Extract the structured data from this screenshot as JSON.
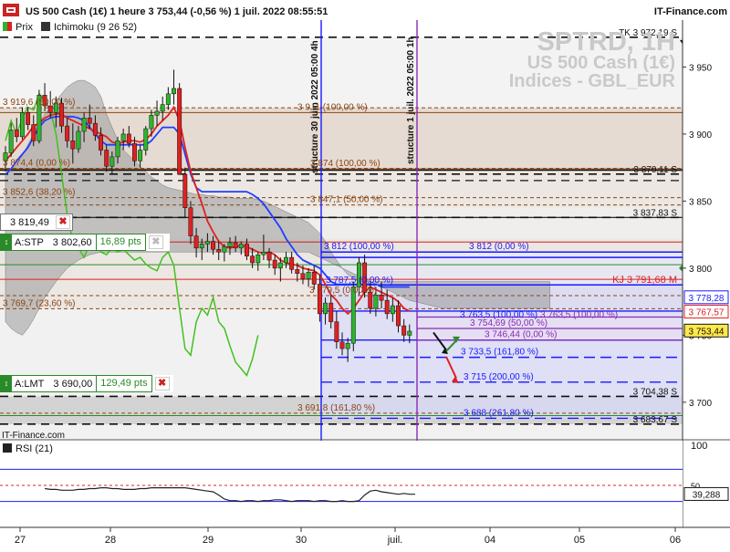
{
  "header": {
    "title": "US 500 Cash (1€) 1 heure 3 753,44 (-0,56 %) 1 juil. 2022 08:55:51",
    "brand": "IT-Finance.com"
  },
  "legend": {
    "price_label": "Prix",
    "ichimoku_label": "Ichimoku (9 26 52)"
  },
  "watermark": {
    "symbol": "SPTRD, 1H",
    "name": "US 500 Cash (1€)",
    "group": "Indices - GBL_EUR"
  },
  "footer_brand": "IT-Finance.com",
  "colors": {
    "price_up": "#2db52d",
    "price_down": "#e02020",
    "tenkan": "#e02020",
    "kijun": "#1f3fff",
    "chikou": "#44c020",
    "cloud": "#9a9a9a",
    "fib": "#8b4513",
    "projection": "#1a1aff",
    "vertical_magenta": "#8a2bb5",
    "rsi": "#222222"
  },
  "chart_data": [
    {
      "type": "line",
      "title": "US 500 Cash (1€) 1 heure",
      "ylim": [
        3672,
        3985
      ],
      "y_ticks": [
        3950,
        3900,
        3850,
        3800,
        3750,
        3700
      ],
      "y_tick_labels": [
        "3 950",
        "3 900",
        "3 850",
        "3 800",
        "3 750",
        "3 700"
      ],
      "x_tick_labels": [
        "27",
        "28",
        "29",
        "30",
        "juil.",
        "04",
        "05",
        "06"
      ],
      "grid": false,
      "candles": [
        [
          3880,
          3891,
          3872,
          3886
        ],
        [
          3886,
          3908,
          3883,
          3903
        ],
        [
          3903,
          3912,
          3894,
          3898
        ],
        [
          3898,
          3920,
          3896,
          3916
        ],
        [
          3916,
          3920,
          3903,
          3907
        ],
        [
          3907,
          3914,
          3891,
          3895
        ],
        [
          3895,
          3933,
          3893,
          3929
        ],
        [
          3929,
          3938,
          3917,
          3921
        ],
        [
          3921,
          3932,
          3912,
          3916
        ],
        [
          3916,
          3928,
          3905,
          3923
        ],
        [
          3923,
          3927,
          3901,
          3906
        ],
        [
          3906,
          3912,
          3890,
          3895
        ],
        [
          3895,
          3908,
          3878,
          3889
        ],
        [
          3889,
          3906,
          3886,
          3902
        ],
        [
          3902,
          3916,
          3894,
          3912
        ],
        [
          3912,
          3922,
          3904,
          3908
        ],
        [
          3908,
          3914,
          3895,
          3899
        ],
        [
          3899,
          3905,
          3884,
          3888
        ],
        [
          3888,
          3892,
          3872,
          3876
        ],
        [
          3876,
          3887,
          3870,
          3883
        ],
        [
          3883,
          3898,
          3878,
          3895
        ],
        [
          3895,
          3904,
          3888,
          3900
        ],
        [
          3900,
          3906,
          3890,
          3893
        ],
        [
          3893,
          3898,
          3876,
          3880
        ],
        [
          3880,
          3892,
          3875,
          3888
        ],
        [
          3888,
          3906,
          3884,
          3904
        ],
        [
          3904,
          3918,
          3898,
          3914
        ],
        [
          3914,
          3925,
          3906,
          3917
        ],
        [
          3917,
          3928,
          3910,
          3922
        ],
        [
          3922,
          3935,
          3918,
          3930
        ],
        [
          3930,
          3948,
          3922,
          3934
        ],
        [
          3934,
          3938,
          3885,
          3870
        ],
        [
          3870,
          3875,
          3838,
          3845
        ],
        [
          3845,
          3850,
          3818,
          3824
        ],
        [
          3824,
          3830,
          3808,
          3815
        ],
        [
          3815,
          3822,
          3806,
          3818
        ],
        [
          3818,
          3826,
          3812,
          3820
        ],
        [
          3820,
          3824,
          3810,
          3814
        ],
        [
          3814,
          3820,
          3806,
          3812
        ],
        [
          3812,
          3818,
          3805,
          3816
        ],
        [
          3816,
          3823,
          3810,
          3819
        ],
        [
          3819,
          3824,
          3812,
          3815
        ],
        [
          3815,
          3820,
          3810,
          3818
        ],
        [
          3818,
          3822,
          3806,
          3809
        ],
        [
          3809,
          3815,
          3800,
          3804
        ],
        [
          3804,
          3812,
          3798,
          3810
        ],
        [
          3810,
          3825,
          3806,
          3812
        ],
        [
          3812,
          3815,
          3800,
          3806
        ],
        [
          3806,
          3810,
          3795,
          3800
        ],
        [
          3800,
          3808,
          3790,
          3804
        ],
        [
          3804,
          3812,
          3800,
          3808
        ],
        [
          3808,
          3812,
          3796,
          3799
        ],
        [
          3799,
          3804,
          3790,
          3796
        ],
        [
          3796,
          3802,
          3788,
          3792
        ],
        [
          3792,
          3800,
          3786,
          3797
        ],
        [
          3797,
          3802,
          3784,
          3788
        ],
        [
          3788,
          3795,
          3760,
          3766
        ],
        [
          3766,
          3778,
          3758,
          3774
        ],
        [
          3774,
          3780,
          3755,
          3760
        ],
        [
          3760,
          3768,
          3740,
          3745
        ],
        [
          3745,
          3752,
          3735,
          3740
        ],
        [
          3740,
          3748,
          3730,
          3744
        ],
        [
          3744,
          3790,
          3738,
          3786
        ],
        [
          3786,
          3808,
          3780,
          3804
        ],
        [
          3804,
          3810,
          3778,
          3782
        ],
        [
          3782,
          3790,
          3766,
          3770
        ],
        [
          3770,
          3786,
          3764,
          3780
        ],
        [
          3780,
          3790,
          3770,
          3776
        ],
        [
          3776,
          3784,
          3762,
          3766
        ],
        [
          3766,
          3778,
          3760,
          3772
        ],
        [
          3772,
          3776,
          3752,
          3757
        ],
        [
          3757,
          3762,
          3745,
          3750
        ],
        [
          3750,
          3758,
          3744,
          3753
        ]
      ],
      "tenkan": [
        3880,
        3885,
        3890,
        3895,
        3900,
        3906,
        3908,
        3912,
        3914,
        3915,
        3915,
        3912,
        3910,
        3908,
        3906,
        3904,
        3902,
        3900,
        3898,
        3894,
        3893,
        3894,
        3895,
        3895,
        3894,
        3896,
        3900,
        3906,
        3910,
        3914,
        3920,
        3910,
        3890,
        3872,
        3860,
        3848,
        3835,
        3827,
        3820,
        3816,
        3815,
        3816,
        3817,
        3816,
        3814,
        3812,
        3811,
        3812,
        3810,
        3806,
        3804,
        3803,
        3802,
        3800,
        3799,
        3798,
        3795,
        3788,
        3780,
        3776,
        3770,
        3766,
        3770,
        3776,
        3782,
        3786,
        3784,
        3782,
        3780,
        3778,
        3775,
        3770,
        3768
      ],
      "kijun": [
        3870,
        3874,
        3880,
        3885,
        3890,
        3898,
        3905,
        3910,
        3912,
        3913,
        3913,
        3913,
        3913,
        3912,
        3910,
        3905,
        3900,
        3895,
        3892,
        3892,
        3892,
        3892,
        3892,
        3892,
        3892,
        3892,
        3895,
        3900,
        3905,
        3905,
        3905,
        3900,
        3885,
        3870,
        3860,
        3857,
        3857,
        3857,
        3857,
        3857,
        3857,
        3857,
        3857,
        3857,
        3855,
        3852,
        3848,
        3842,
        3836,
        3830,
        3822,
        3816,
        3810,
        3806,
        3804,
        3802,
        3800,
        3795,
        3790,
        3788,
        3788,
        3788,
        3788,
        3788,
        3788,
        3788,
        3788,
        3786,
        3786,
        3786,
        3786,
        3786,
        3786
      ],
      "chikou": [
        3895,
        3910,
        3900,
        3912,
        3920,
        3918,
        3930,
        3925,
        3918,
        3900,
        3870,
        3840,
        3820,
        3815,
        3808,
        3818,
        3822,
        3812,
        3810,
        3815,
        3812,
        3814,
        3810,
        3806,
        3808,
        3803,
        3800,
        3798,
        3808,
        3812,
        3802,
        3770,
        3740,
        3735,
        3760,
        3770,
        3765,
        3778,
        3760,
        3755,
        3742,
        3730,
        3725,
        3720,
        3732,
        3750
      ],
      "cloud_top": [
        3870,
        3872,
        3878,
        3884,
        3892,
        3900,
        3908,
        3915,
        3920,
        3925,
        3930,
        3935,
        3938,
        3940,
        3940,
        3938,
        3935,
        3928,
        3915,
        3905,
        3895,
        3888,
        3884,
        3880,
        3876,
        3872,
        3868,
        3865,
        3862,
        3860,
        3859,
        3858,
        3857,
        3856,
        3855,
        3855,
        3854,
        3854,
        3853,
        3853,
        3853,
        3852,
        3852,
        3852,
        3852,
        3851,
        3850,
        3848,
        3846,
        3844,
        3842,
        3840,
        3838,
        3836,
        3834,
        3830,
        3826,
        3820,
        3812,
        3806,
        3800,
        3795,
        3792,
        3790,
        3790,
        3790,
        3790,
        3790,
        3790,
        3790,
        3790,
        3790,
        3790,
        3790,
        3790,
        3790,
        3790,
        3790,
        3790,
        3790,
        3790,
        3790,
        3790,
        3790,
        3790,
        3790,
        3790,
        3790,
        3790,
        3790,
        3790,
        3790,
        3790,
        3790,
        3790,
        3790,
        3790,
        3790
      ],
      "cloud_bottom": [
        3760,
        3755,
        3752,
        3750,
        3755,
        3762,
        3770,
        3778,
        3784,
        3790,
        3795,
        3800,
        3803,
        3806,
        3808,
        3810,
        3811,
        3812,
        3812,
        3812,
        3812,
        3812,
        3812,
        3812,
        3812,
        3812,
        3812,
        3812,
        3812,
        3812,
        3812,
        3812,
        3812,
        3812,
        3812,
        3812,
        3812,
        3812,
        3812,
        3812,
        3812,
        3812,
        3812,
        3812,
        3812,
        3812,
        3812,
        3812,
        3812,
        3812,
        3812,
        3812,
        3812,
        3812,
        3812,
        3810,
        3808,
        3806,
        3804,
        3802,
        3800,
        3798,
        3796,
        3794,
        3792,
        3790,
        3788,
        3786,
        3784,
        3782,
        3780,
        3778,
        3776,
        3775,
        3774,
        3773,
        3772,
        3771,
        3770,
        3770,
        3770,
        3770,
        3770,
        3770,
        3770,
        3770,
        3770,
        3770,
        3770,
        3770,
        3770,
        3770,
        3770,
        3770,
        3770,
        3770,
        3770,
        3770
      ],
      "fib_levels": [
        {
          "value": 3919.6,
          "label": "3 919,6 (50,00 %)",
          "style": "dashed"
        },
        {
          "value": 3874.4,
          "label": "3 874,4 (0,00 %)",
          "style": "dashed"
        },
        {
          "value": 3852.6,
          "label": "3 852,6 (38,20 %)",
          "style": "dashed"
        },
        {
          "value": 3769.7,
          "label": "3 769,7 (23,60 %)",
          "style": "dashed"
        },
        {
          "value": 3691.8,
          "label": "3 691,8 (161,80 %)",
          "style": "dashed"
        },
        {
          "value": 3916,
          "label": "3 9_1 (100,00 %)",
          "style": "solid"
        },
        {
          "value": 3874,
          "label": "3 874 (100,00 %)",
          "style": "solid"
        },
        {
          "value": 3847.1,
          "label": "3 847,1 (50,00 %)",
          "style": "dashed"
        },
        {
          "value": 3779.5,
          "label": "3 779,5 (0,00 %)",
          "style": "dashed"
        }
      ],
      "projection_levels": [
        {
          "value": 3812,
          "label": "3 812 (100,00 %)"
        },
        {
          "value": 3812,
          "label": "3 812 (0,00 %)"
        },
        {
          "value": 3787,
          "label": "3 787,5 (0,00 %)"
        },
        {
          "value": 3768,
          "label": "3 763,5 (100,00 %)"
        },
        {
          "value": 3755,
          "label": "3 754,69 (50,00 %)"
        },
        {
          "value": 3746.4,
          "label": "3 746,44 (0,00 %)"
        },
        {
          "value": 3733.5,
          "label": "3 733,5 (161,80 %)"
        },
        {
          "value": 3715,
          "label": "3 715 (200,00 %)"
        },
        {
          "value": 3688,
          "label": "3 688 (261,80 %)"
        },
        {
          "value": 3763.5,
          "label": "3 763,5 (100,00 %)"
        }
      ],
      "support_resistance": [
        {
          "value": 3972.19,
          "label": "TK 3 972,19 S"
        },
        {
          "value": 3870.11,
          "label": "3 870,11 S"
        },
        {
          "value": 3837.83,
          "label": "3 837,83 S"
        },
        {
          "value": 3704.38,
          "label": "3 704,38 S"
        },
        {
          "value": 3683.67,
          "label": "3 683,67 S"
        }
      ],
      "kijun_level": {
        "value": 3791.68,
        "label": "KJ 3 791,68 M"
      },
      "price_badges": [
        {
          "value": 3778.28,
          "label": "3 778,28"
        },
        {
          "value": 3767.57,
          "label": "3 767,57"
        },
        {
          "value": 3753.44,
          "label": "3 753,44"
        }
      ],
      "vertical_annotations": [
        {
          "label": "structure 30 juin 2022 05:00 4h"
        },
        {
          "label": "structure 1 juil. 2022 05:00 1h"
        }
      ],
      "orders": [
        {
          "label": "3 819,49",
          "value": 3819.49
        },
        {
          "type": "A:STP",
          "price": "3 802,60",
          "distance": "16,89 pts"
        },
        {
          "type": "A:LMT",
          "price": "3 690,00",
          "distance": "129,49 pts"
        }
      ]
    },
    {
      "type": "line",
      "title": "RSI (21)",
      "ylim": [
        0,
        100
      ],
      "y_tick_labels": [
        "100",
        "50"
      ],
      "levels": [
        70,
        50,
        30
      ],
      "current": "39,288",
      "values": [
        46,
        45,
        45,
        44,
        44,
        44,
        45,
        45,
        46,
        46,
        47,
        47,
        46,
        46,
        45,
        45,
        45,
        46,
        46,
        47,
        47,
        47,
        47,
        47,
        47,
        47,
        46,
        45,
        44,
        43,
        42,
        38,
        33,
        31,
        31,
        30,
        31,
        31,
        30,
        31,
        31,
        32,
        32,
        31,
        30,
        31,
        31,
        31,
        30,
        31,
        31,
        30,
        30,
        31,
        30,
        30,
        31,
        38,
        43,
        44,
        42,
        41,
        40,
        39,
        40,
        39,
        39
      ]
    }
  ]
}
